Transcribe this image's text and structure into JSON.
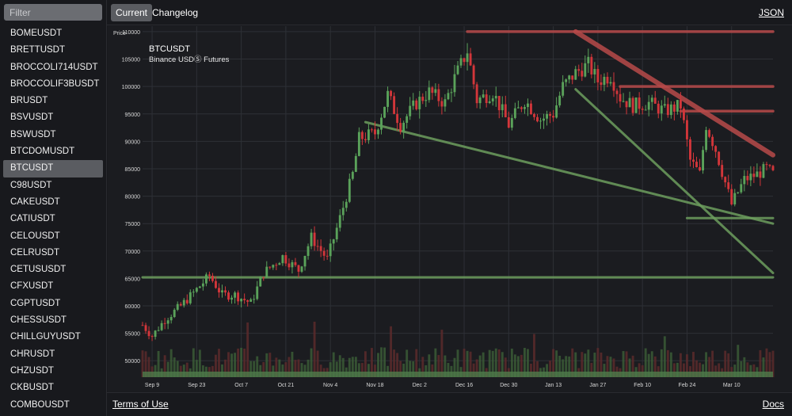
{
  "sidebar": {
    "filter_placeholder": "Filter",
    "selected": "BTCUSDT",
    "symbols": [
      "BOMEUSDT",
      "BRETTUSDT",
      "BROCCOLI714USDT",
      "BROCCOLIF3BUSDT",
      "BRUSDT",
      "BSVUSDT",
      "BSWUSDT",
      "BTCDOMUSDT",
      "BTCUSDT",
      "C98USDT",
      "CAKEUSDT",
      "CATIUSDT",
      "CELOUSDT",
      "CELRUSDT",
      "CETUSUSDT",
      "CFXUSDT",
      "CGPTUSDT",
      "CHESSUSDT",
      "CHILLGUYUSDT",
      "CHRUSDT",
      "CHZUSDT",
      "CKBUSDT",
      "COMBOUSDT"
    ]
  },
  "topbar": {
    "tab_current": "Current",
    "tab_changelog": "Changelog",
    "json_link": "JSON"
  },
  "footer": {
    "terms": "Terms of Use",
    "docs": "Docs"
  },
  "colors": {
    "up": "#5aa25a",
    "down": "#d2363a",
    "resistance": "#b84a4a",
    "support": "#6d9e5e",
    "grid": "#2e3036",
    "background": "#1b1c20"
  },
  "chart_data": {
    "type": "candlestick",
    "title": "BTCUSDT",
    "subtitle": "Binance USDⓈ Futures",
    "ylabel": "Price",
    "xlabel": "",
    "ylim": [
      47000,
      111000
    ],
    "grid": true,
    "x_ticks": [
      "Sep 9",
      "Sep 23",
      "Oct 7",
      "Oct 21",
      "Nov 4",
      "Nov 18",
      "Dec 2",
      "Dec 16",
      "Dec 30",
      "Jan 13",
      "Jan 27",
      "Feb 10",
      "Feb 24",
      "Mar 10"
    ],
    "y_ticks": [
      50000,
      55000,
      60000,
      65000,
      70000,
      75000,
      80000,
      85000,
      90000,
      95000,
      100000,
      105000,
      110000
    ],
    "date_range": [
      "2024-09-06",
      "2025-03-23"
    ],
    "anchors": [
      [
        "2024-09-06",
        56500
      ],
      [
        "2024-09-09",
        54500
      ],
      [
        "2024-09-13",
        57500
      ],
      [
        "2024-09-18",
        60000
      ],
      [
        "2024-09-23",
        63000
      ],
      [
        "2024-09-27",
        65500
      ],
      [
        "2024-10-01",
        62000
      ],
      [
        "2024-10-05",
        62000
      ],
      [
        "2024-10-10",
        60500
      ],
      [
        "2024-10-14",
        66000
      ],
      [
        "2024-10-20",
        69000
      ],
      [
        "2024-10-25",
        66500
      ],
      [
        "2024-10-29",
        72500
      ],
      [
        "2024-11-03",
        68500
      ],
      [
        "2024-11-07",
        76000
      ],
      [
        "2024-11-11",
        84000
      ],
      [
        "2024-11-13",
        90500
      ],
      [
        "2024-11-18",
        91500
      ],
      [
        "2024-11-22",
        98500
      ],
      [
        "2024-11-26",
        93000
      ],
      [
        "2024-12-01",
        97000
      ],
      [
        "2024-12-05",
        99000
      ],
      [
        "2024-12-10",
        97000
      ],
      [
        "2024-12-13",
        101500
      ],
      [
        "2024-12-17",
        106500
      ],
      [
        "2024-12-20",
        97500
      ],
      [
        "2024-12-25",
        99000
      ],
      [
        "2024-12-30",
        93000
      ],
      [
        "2025-01-04",
        97500
      ],
      [
        "2025-01-09",
        94000
      ],
      [
        "2025-01-13",
        95000
      ],
      [
        "2025-01-16",
        100000
      ],
      [
        "2025-01-20",
        102500
      ],
      [
        "2025-01-24",
        104000
      ],
      [
        "2025-01-27",
        101000
      ],
      [
        "2025-01-31",
        102000
      ],
      [
        "2025-02-03",
        98000
      ],
      [
        "2025-02-07",
        96500
      ],
      [
        "2025-02-12",
        97000
      ],
      [
        "2025-02-17",
        95500
      ],
      [
        "2025-02-22",
        96500
      ],
      [
        "2025-02-25",
        86500
      ],
      [
        "2025-02-28",
        84000
      ],
      [
        "2025-03-02",
        93000
      ],
      [
        "2025-03-05",
        88500
      ],
      [
        "2025-03-10",
        78500
      ],
      [
        "2025-03-14",
        83000
      ],
      [
        "2025-03-18",
        84000
      ],
      [
        "2025-03-21",
        85000
      ],
      [
        "2025-03-23",
        84000
      ]
    ],
    "volume": {
      "range": [
        0,
        1
      ],
      "typical": 0.35,
      "max": 1.0
    },
    "trendlines": {
      "resistance": [
        {
          "from": [
            "2024-12-17",
            110000
          ],
          "to": [
            "2025-03-23",
            110000
          ]
        },
        {
          "from": [
            "2025-01-20",
            110000
          ],
          "to": [
            "2025-03-23",
            87500
          ]
        },
        {
          "from": [
            "2025-02-03",
            100000
          ],
          "to": [
            "2025-03-23",
            100000
          ]
        },
        {
          "from": [
            "2025-02-22",
            95500
          ],
          "to": [
            "2025-03-23",
            95500
          ]
        }
      ],
      "support": [
        {
          "from": [
            "2024-09-06",
            65200
          ],
          "to": [
            "2025-03-23",
            65200
          ]
        },
        {
          "from": [
            "2024-11-15",
            93500
          ],
          "to": [
            "2025-03-23",
            75000
          ]
        },
        {
          "from": [
            "2025-01-20",
            99500
          ],
          "to": [
            "2025-03-23",
            66000
          ]
        },
        {
          "from": [
            "2025-02-24",
            76000
          ],
          "to": [
            "2025-03-23",
            76000
          ]
        }
      ]
    }
  }
}
